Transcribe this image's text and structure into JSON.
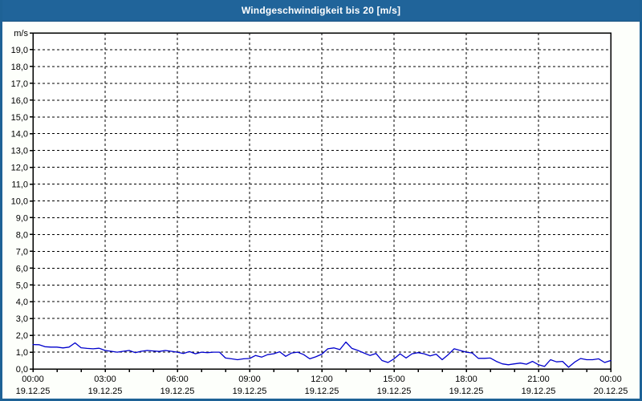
{
  "colors": {
    "titlebar_bg": "#20649a",
    "window_border": "#1e6296",
    "page_bg": "#fdfffb",
    "plot_bg": "#ffffff",
    "grid": "#000000",
    "axis_text": "#000000",
    "title_text": "#ffffff",
    "line": "#0000cc"
  },
  "chart_data": {
    "type": "line",
    "title": "Windgeschwindigkeit bis 20 [m/s]",
    "unit_label": "m/s",
    "ylim": [
      0,
      20
    ],
    "y_tick_step": 1,
    "y_tick_labels": [
      "0,0",
      "1,0",
      "2,0",
      "3,0",
      "4,0",
      "5,0",
      "6,0",
      "7,0",
      "8,0",
      "9,0",
      "10,0",
      "11,0",
      "12,0",
      "13,0",
      "14,0",
      "15,0",
      "16,0",
      "17,0",
      "18,0",
      "19,0"
    ],
    "xlim_hours": [
      0,
      24
    ],
    "x_minor_tick_hours": 1,
    "x_gridline_hours": [
      3,
      6,
      9,
      12,
      15,
      18,
      21
    ],
    "grid_style": "dashed",
    "legend": "none",
    "x_major_ticks": [
      {
        "hour": 0,
        "time": "00:00",
        "date": "19.12.25"
      },
      {
        "hour": 3,
        "time": "03:00",
        "date": "19.12.25"
      },
      {
        "hour": 6,
        "time": "06:00",
        "date": "19.12.25"
      },
      {
        "hour": 9,
        "time": "09:00",
        "date": "19.12.25"
      },
      {
        "hour": 12,
        "time": "12:00",
        "date": "19.12.25"
      },
      {
        "hour": 15,
        "time": "15:00",
        "date": "19.12.25"
      },
      {
        "hour": 18,
        "time": "18:00",
        "date": "19.12.25"
      },
      {
        "hour": 21,
        "time": "21:00",
        "date": "19.12.25"
      },
      {
        "hour": 24,
        "time": "00:00",
        "date": "20.12.25"
      }
    ],
    "series": [
      {
        "name": "Windgeschwindigkeit",
        "color": "#0000cc",
        "x_start_hour": 0,
        "x_step_hours": 0.25,
        "values": [
          1.45,
          1.44,
          1.32,
          1.3,
          1.3,
          1.25,
          1.3,
          1.55,
          1.26,
          1.22,
          1.2,
          1.23,
          1.1,
          1.05,
          1.0,
          1.05,
          1.1,
          0.97,
          1.05,
          1.1,
          1.07,
          1.04,
          1.1,
          1.05,
          1.0,
          0.92,
          1.03,
          0.9,
          1.0,
          0.97,
          1.0,
          1.0,
          0.65,
          0.6,
          0.55,
          0.6,
          0.62,
          0.8,
          0.7,
          0.85,
          0.9,
          1.02,
          0.75,
          0.95,
          1.0,
          0.85,
          0.6,
          0.72,
          0.88,
          1.2,
          1.25,
          1.15,
          1.6,
          1.22,
          1.1,
          0.95,
          0.8,
          0.92,
          0.5,
          0.38,
          0.6,
          0.9,
          0.65,
          0.9,
          0.97,
          0.9,
          0.78,
          0.88,
          0.55,
          0.85,
          1.2,
          1.1,
          1.0,
          0.95,
          0.63,
          0.63,
          0.65,
          0.45,
          0.3,
          0.25,
          0.3,
          0.35,
          0.28,
          0.45,
          0.25,
          0.15,
          0.55,
          0.42,
          0.45,
          0.1,
          0.4,
          0.62,
          0.55,
          0.55,
          0.6,
          0.38,
          0.5
        ]
      }
    ]
  }
}
